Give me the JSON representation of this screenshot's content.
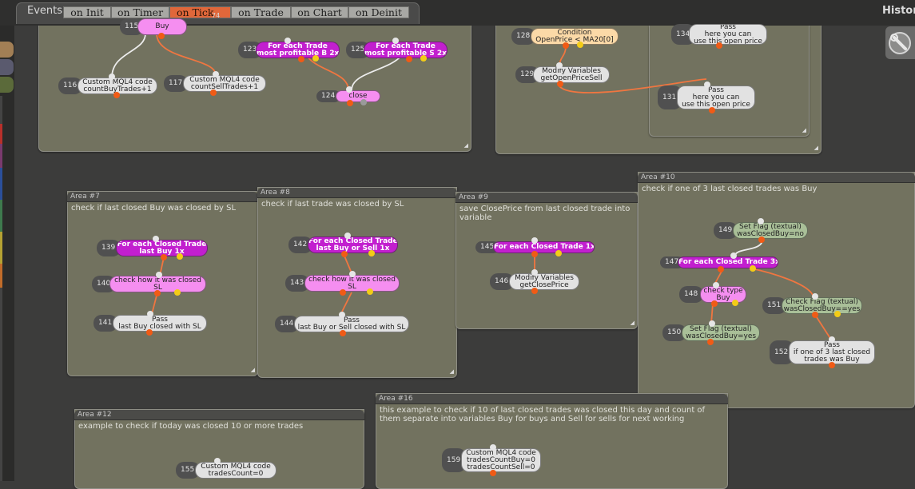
{
  "topbar": {
    "events_label": "Events",
    "history_label": "History",
    "tabs": [
      {
        "label": "on Init"
      },
      {
        "label": "on Timer"
      },
      {
        "label": "on Tick",
        "badge": "74"
      },
      {
        "label": "on Trade"
      },
      {
        "label": "on Chart"
      },
      {
        "label": "on Deinit"
      }
    ]
  },
  "colors": {
    "tab_active": "#e0673a",
    "area_fill": "#72725f",
    "node_magenta": "#c21fcf",
    "node_pink": "#f58ef0",
    "node_gray": "#e2e2e2",
    "node_peach": "#fbd9a7",
    "node_green": "#a9bf98",
    "wire": "#f07640",
    "output_pin": "#f05b16",
    "alt_pin": "#f3cc17"
  },
  "icons": {
    "toolbox": "wrench-icon"
  },
  "areas": [
    {
      "id": "a0",
      "title": "",
      "description": "",
      "nodes": [
        {
          "num": "115",
          "lines": [
            "Buy"
          ]
        },
        {
          "num": "123",
          "lines": [
            "For each Trade",
            "most profitable B 2x"
          ]
        },
        {
          "num": "125",
          "lines": [
            "For each Trade",
            "most profitable S 2x"
          ]
        },
        {
          "num": "116",
          "lines": [
            "Custom MQL4 code",
            "countBuyTrades+1"
          ]
        },
        {
          "num": "117",
          "lines": [
            "Custom MQL4 code",
            "countSellTrades+1"
          ]
        },
        {
          "num": "124",
          "lines": [
            "close"
          ]
        }
      ]
    },
    {
      "id": "a1",
      "title": "",
      "description": "",
      "nodes": [
        {
          "num": "128",
          "lines": [
            "Condition",
            "OpenPrice < MA20[0]"
          ]
        },
        {
          "num": "129",
          "lines": [
            "Modify Variables",
            "getOpenPriceSell"
          ]
        }
      ]
    },
    {
      "id": "a2",
      "title": "",
      "description": "",
      "nodes": [
        {
          "num": "134",
          "lines": [
            "Pass",
            "here you can",
            "use this open price"
          ]
        },
        {
          "num": "131",
          "lines": [
            "Pass",
            "here you can",
            "use this open price"
          ]
        }
      ]
    },
    {
      "id": "a7",
      "title": "Area #7",
      "description": "check if last closed Buy was closed by SL",
      "nodes": [
        {
          "num": "139",
          "lines": [
            "For each Closed Trade",
            "last Buy 1x"
          ]
        },
        {
          "num": "140",
          "lines": [
            "check how it was closed",
            "SL"
          ]
        },
        {
          "num": "141",
          "lines": [
            "Pass",
            "last Buy closed with SL"
          ]
        }
      ]
    },
    {
      "id": "a8",
      "title": "Area #8",
      "description": "check if last trade was closed by SL",
      "nodes": [
        {
          "num": "142",
          "lines": [
            "For each Closed Trade",
            "last Buy or Sell 1x"
          ]
        },
        {
          "num": "143",
          "lines": [
            "check how it was closed",
            "SL"
          ]
        },
        {
          "num": "144",
          "lines": [
            "Pass",
            "last Buy or Sell closed with SL"
          ]
        }
      ]
    },
    {
      "id": "a9",
      "title": "Area #9",
      "description": "save ClosePrice from last closed trade into variable",
      "nodes": [
        {
          "num": "145",
          "lines": [
            "For each Closed Trade 1x"
          ]
        },
        {
          "num": "146",
          "lines": [
            "Modify Variables",
            "getClosePrice"
          ]
        }
      ]
    },
    {
      "id": "a10",
      "title": "Area #10",
      "description": "check if one of 3 last closed trades was Buy",
      "nodes": [
        {
          "num": "149",
          "lines": [
            "Set Flag (textual)",
            "wasClosedBuy=no"
          ]
        },
        {
          "num": "147",
          "lines": [
            "For each Closed Trade 3x"
          ]
        },
        {
          "num": "148",
          "lines": [
            "check type",
            "Buy"
          ]
        },
        {
          "num": "151",
          "lines": [
            "Check Flag (textual)",
            "wasClosedBuy==yes"
          ]
        },
        {
          "num": "150",
          "lines": [
            "Set Flag (textual)",
            "wasClosedBuy=yes"
          ]
        },
        {
          "num": "152",
          "lines": [
            "Pass",
            "if one of 3 last closed",
            "trades was Buy"
          ]
        }
      ]
    },
    {
      "id": "a12",
      "title": "Area #12",
      "description": "example to check if today was closed 10 or more trades",
      "nodes": [
        {
          "num": "155",
          "lines": [
            "Custom MQL4 code",
            "tradesCount=0"
          ]
        }
      ]
    },
    {
      "id": "a16",
      "title": "Area #16",
      "description": "this example to check if 10 of last closed trades was closed this day and count of them separate into variables Buy for buys and Sell for sells for next working",
      "nodes": [
        {
          "num": "159",
          "lines": [
            "Custom MQL4 code",
            "tradesCountBuy=0",
            "tradesCountSell=0"
          ]
        }
      ]
    }
  ]
}
